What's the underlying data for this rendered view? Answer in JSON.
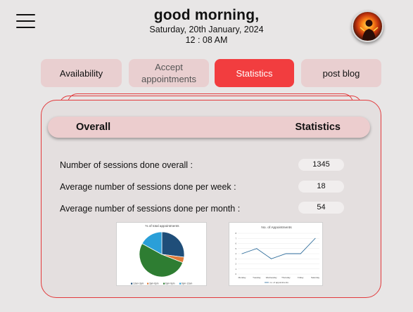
{
  "header": {
    "greeting": "good morning,",
    "date": "Saturday, 20th January, 2024",
    "time": "12 : 08 AM"
  },
  "icons": {
    "menu": "hamburger-menu-icon",
    "avatar": "profile-avatar"
  },
  "tabs": [
    {
      "label": "Availability",
      "active": false
    },
    {
      "label": "Accept\nappointments",
      "active": false
    },
    {
      "label": "Statistics",
      "active": true
    },
    {
      "label": "post blog",
      "active": false
    }
  ],
  "panel": {
    "header_left": "Overall",
    "header_right": "Statistics",
    "stats": [
      {
        "label": "Number of sessions done overall :",
        "value": "1345"
      },
      {
        "label": "Average number of sessions done per week :",
        "value": "18"
      },
      {
        "label": "Average number of sessions done per month :",
        "value": "54"
      }
    ]
  },
  "colors": {
    "accent": "#f23d3f",
    "tab_bg": "#e9cfd0",
    "panel_border": "#e23a3c",
    "background": "#e8e6e6"
  },
  "chart_data": [
    {
      "type": "pie",
      "title": "% of total appointments",
      "categories": [
        "12am-3pm",
        "3pm-6pm",
        "6pm-9pm",
        "9pm-12am"
      ],
      "values": [
        27,
        4,
        52,
        17
      ],
      "colors": [
        "#1f4e79",
        "#e07b39",
        "#2e7d32",
        "#2a9fd8"
      ],
      "legend_position": "bottom"
    },
    {
      "type": "line",
      "title": "No. of Appointments",
      "categories": [
        "Monday",
        "Tuesday",
        "Wednesday",
        "Thursday",
        "Friday",
        "Saturday"
      ],
      "series": [
        {
          "name": "no. of appointments",
          "values": [
            4,
            5,
            3,
            4,
            4,
            7
          ]
        }
      ],
      "ylim": [
        0,
        8
      ],
      "yticks": [
        "0",
        "1",
        "2",
        "3",
        "4",
        "5",
        "6",
        "7",
        "8"
      ],
      "grid": true,
      "legend_position": "bottom",
      "line_color": "#2b6a99"
    }
  ]
}
